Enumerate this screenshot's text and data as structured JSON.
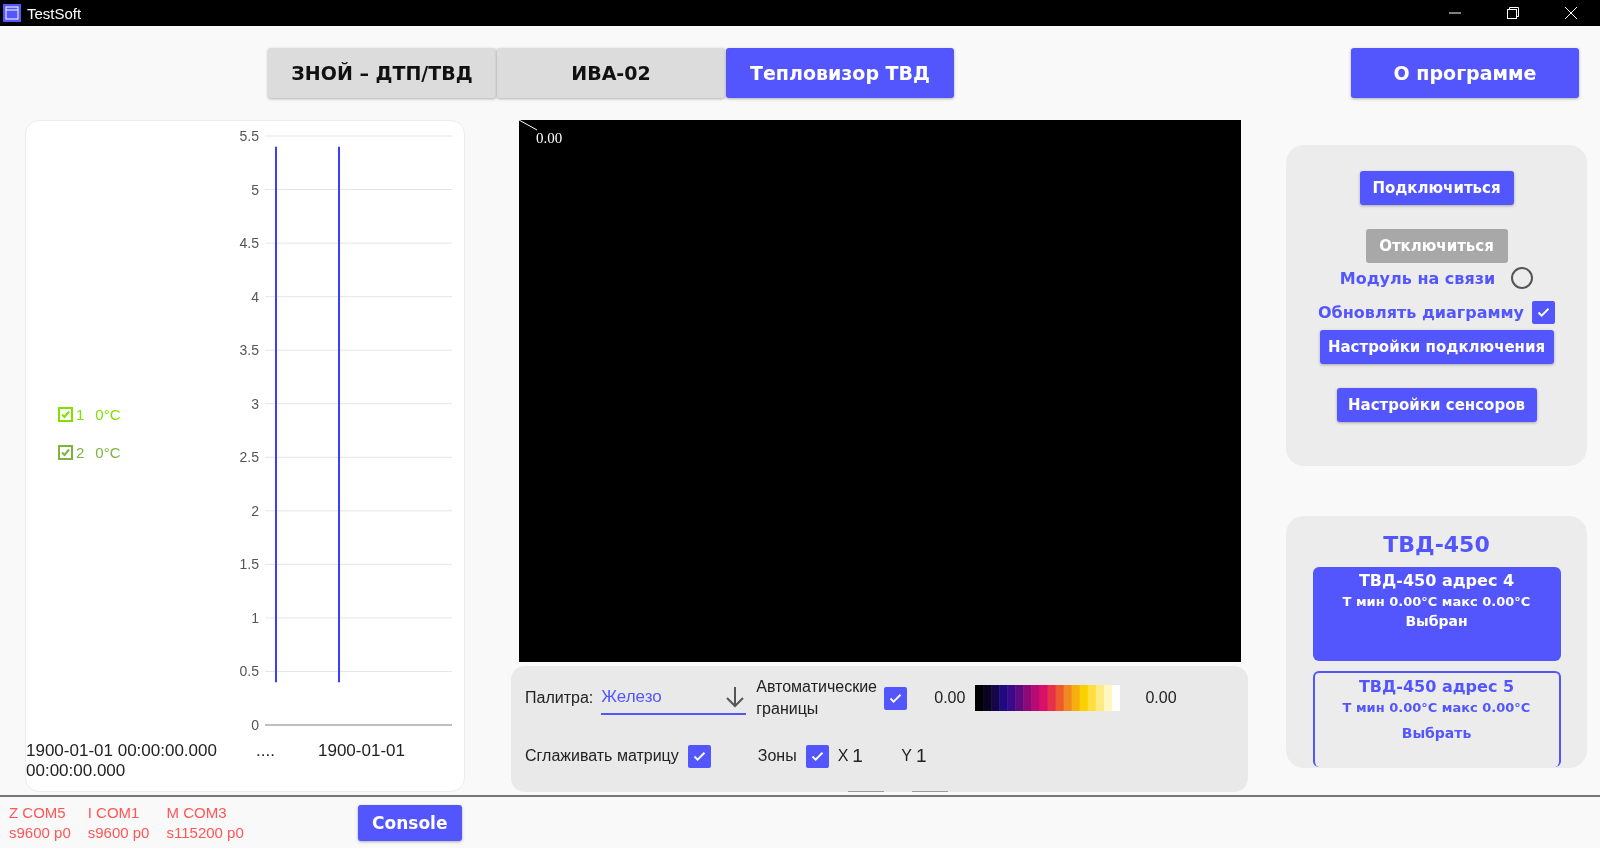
{
  "window": {
    "title": "TestSoft"
  },
  "tabs": [
    {
      "label": "ЗНОЙ – ДТП/ТВД",
      "selected": false
    },
    {
      "label": "ИВА-02",
      "selected": false
    },
    {
      "label": "Тепловизор ТВД",
      "selected": true
    }
  ],
  "about_button": "О программе",
  "chart": {
    "legend": [
      {
        "checked": true,
        "label": "1",
        "value": "0°C",
        "color": "#80e000"
      },
      {
        "checked": true,
        "label": "2",
        "value": "0°C",
        "color": "#7cb342"
      }
    ],
    "y_axis_labels": [
      "5.5",
      "5",
      "4.5",
      "4",
      "3.5",
      "3",
      "2.5",
      "2",
      "1.5",
      "1",
      "0.5",
      "0"
    ],
    "x_labels": [
      "1900-01-01 00:00:00.000",
      "....",
      "1900-01-01",
      "00:00:00.000"
    ]
  },
  "thermal_view": {
    "reading": "0.00"
  },
  "controls": {
    "palette_label": "Палитра:",
    "palette_value": "Железо",
    "auto_bounds": {
      "label": "Автоматические границы",
      "checked": true
    },
    "range_min": "0.00",
    "range_max": "0.00",
    "smooth": {
      "label": "Сглаживать матрицу",
      "checked": true
    },
    "zones": {
      "label": "Зоны",
      "checked": true
    },
    "x_label": "X",
    "x_value": "1",
    "y_label": "Y",
    "y_value": "1"
  },
  "connection": {
    "connect": {
      "label": "Подключиться",
      "disabled": false
    },
    "disconnect": {
      "label": "Отключиться",
      "disabled": true
    },
    "online": {
      "label": "Модуль на связи",
      "on": false
    },
    "update_chart": {
      "label": "Обновлять диаграмму",
      "checked": true
    },
    "buttons": [
      "Настройки подключения",
      "Настройки сенсоров"
    ]
  },
  "sensors": {
    "title": "ТВД-450",
    "items": [
      {
        "name": "ТВД-450 адрес 4",
        "temps": "Т мин 0.00°C макс 0.00°C",
        "action": "Выбран",
        "selected": true
      },
      {
        "name": "ТВД-450 адрес 5",
        "temps": "Т мин 0.00°C макс 0.00°C",
        "action": "Выбрать",
        "selected": false
      }
    ]
  },
  "status": {
    "ports": [
      {
        "name": "Z COM5",
        "params": "s9600 p0"
      },
      {
        "name": "I COM1",
        "params": "s9600 p0"
      },
      {
        "name": "M COM3",
        "params": "s115200 p0"
      }
    ],
    "console_button": "Console"
  }
}
